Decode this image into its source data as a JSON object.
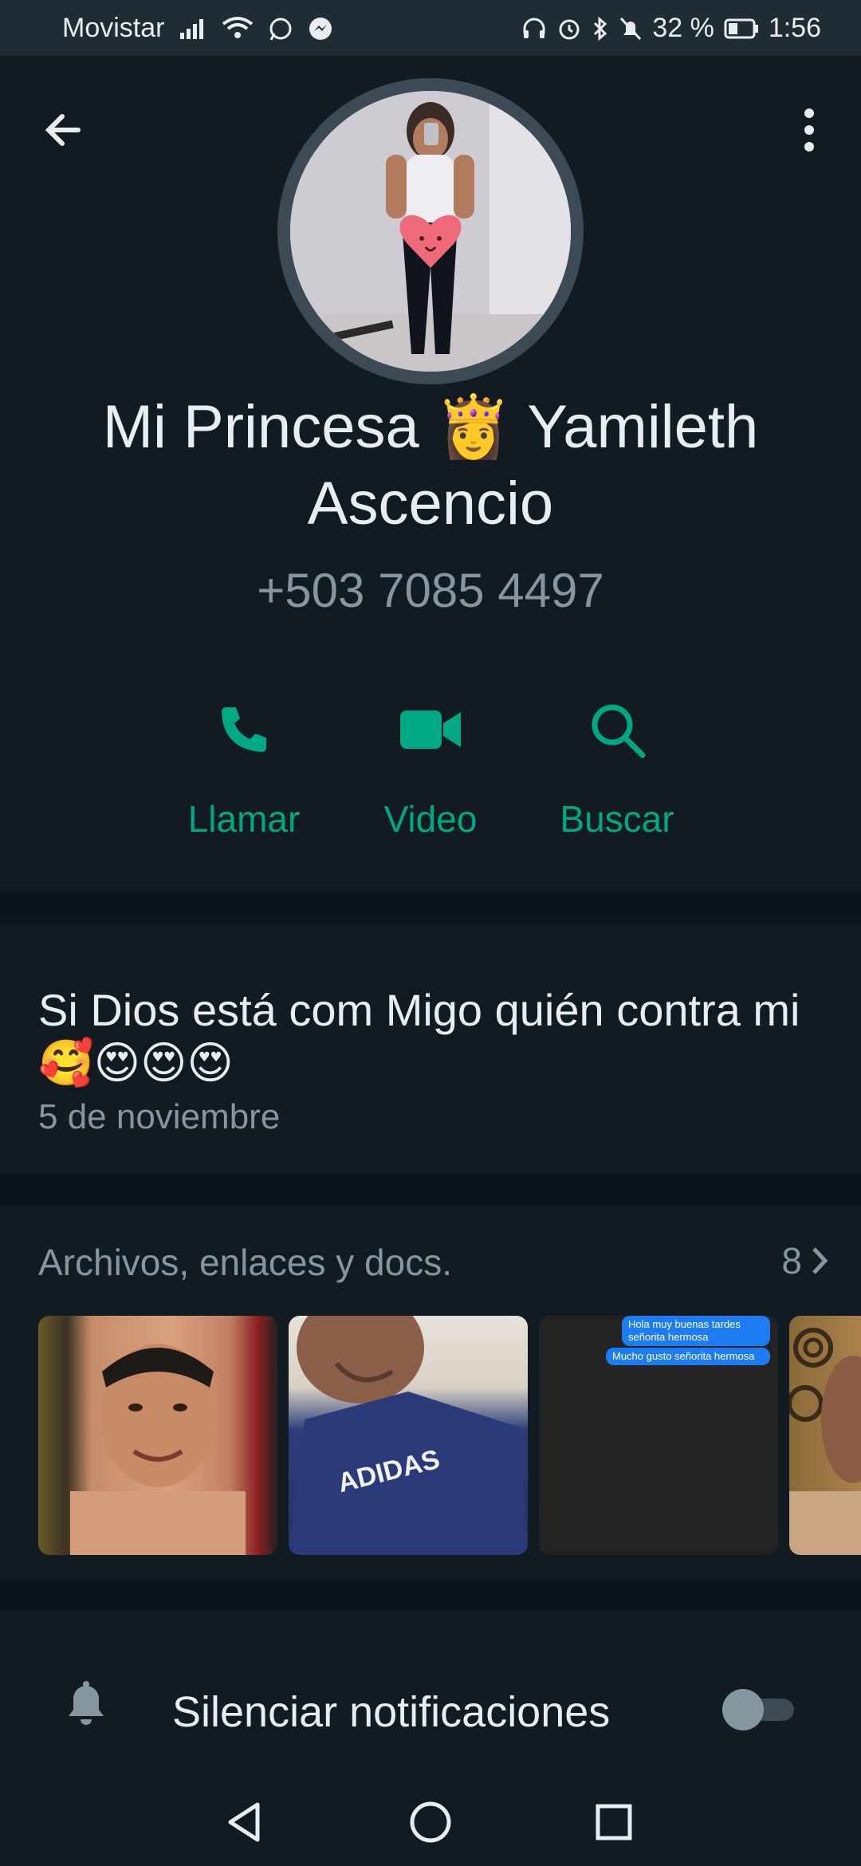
{
  "status_bar": {
    "carrier": "Movistar",
    "battery": "32 %",
    "time": "1:56"
  },
  "profile": {
    "name": "Mi Princesa 👸 Yamileth Ascencio",
    "phone": "+503 7085 4497"
  },
  "actions": [
    {
      "label": "Llamar",
      "icon": "phone-icon"
    },
    {
      "label": "Video",
      "icon": "video-camera-icon"
    },
    {
      "label": "Buscar",
      "icon": "search-icon"
    }
  ],
  "about": {
    "text": "Si Dios está com Migo quién contra mi 🥰😍😍😍",
    "date": "5 de noviembre"
  },
  "media": {
    "title": "Archivos, enlaces y docs.",
    "count": "8",
    "chat_bubbles": [
      "Hola muy buenas tardes señorita hermosa",
      "Mucho gusto señorita hermosa"
    ],
    "shirt_text": "ADIDAS"
  },
  "mute": {
    "label": "Silenciar notificaciones",
    "enabled": false
  },
  "colors": {
    "accent": "#00a884",
    "background": "#0b141a",
    "panel": "#111b21"
  }
}
